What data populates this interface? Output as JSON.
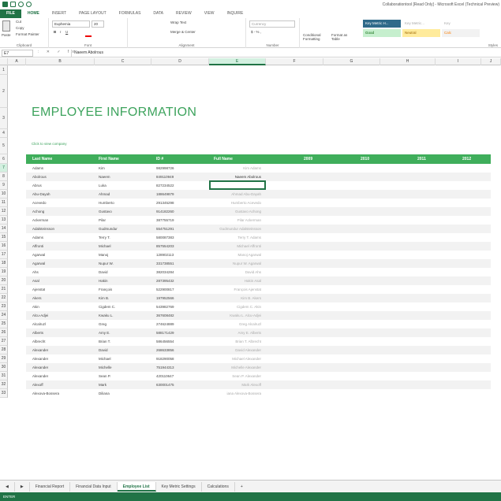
{
  "window": {
    "title": "Collaborationtool [Read Only] - Microsoft Excel (Technical Preview)"
  },
  "tabs": [
    "FILE",
    "HOME",
    "INSERT",
    "PAGE LAYOUT",
    "FORMULAS",
    "DATA",
    "REVIEW",
    "VIEW",
    "INQUIRE"
  ],
  "ribbon": {
    "clipboard": {
      "label": "Clipboard",
      "paste": "Paste",
      "cut": "Cut",
      "copy": "Copy",
      "format_painter": "Format Painter"
    },
    "font": {
      "label": "Font",
      "name": "Euphemia",
      "size": "20"
    },
    "alignment": {
      "label": "Alignment",
      "wrap": "Wrap Text",
      "merge": "Merge & Center"
    },
    "number": {
      "label": "Number",
      "format": "Currency"
    },
    "styles": {
      "label": "Styles",
      "conditional": "Conditional Formatting",
      "format_table": "Format as Table",
      "cells": [
        "Key Metric H...",
        "Key Metric...",
        "Key",
        "Good",
        "Neutral",
        "Calc"
      ]
    }
  },
  "formula_bar": {
    "name_box": "E7",
    "content": "Naeem Abolrous"
  },
  "columns": [
    "A",
    "B",
    "C",
    "D",
    "E",
    "F",
    "G",
    "H",
    "I",
    "J"
  ],
  "rows": [
    "1",
    "2",
    "3",
    "4",
    "5",
    "6",
    "7",
    "8",
    "9",
    "10",
    "11",
    "12",
    "13",
    "14",
    "15",
    "16",
    "17",
    "18",
    "19",
    "20",
    "21",
    "22",
    "23",
    "24",
    "25",
    "26",
    "27",
    "28",
    "29",
    "30",
    "31",
    "32",
    "33"
  ],
  "sheet": {
    "title": "EMPLOYEE  INFORMATION",
    "link": "Click to view company",
    "headers": [
      "Last Name",
      "First Name",
      "ID #",
      "Full Name",
      "2009",
      "2010",
      "2011",
      "2012"
    ],
    "data": [
      [
        "Adams",
        "Kim",
        "982998726",
        "Kim Adams"
      ],
      [
        "Abolrous",
        "Naeem",
        "849110949",
        "Naeem Abolrous"
      ],
      [
        "Abrus",
        "Luka",
        "827234522",
        "Luka Abrus"
      ],
      [
        "Abu-Dayah",
        "Ahmad",
        "188649879",
        "Ahmad Abu-Dayah"
      ],
      [
        "Acevedo",
        "Humberto",
        "291345298",
        "Humberto Acevedo"
      ],
      [
        "Achong",
        "Gustavo",
        "914182260",
        "Gustavo Achong"
      ],
      [
        "Ackerman",
        "Pilar",
        "387755719",
        "Pilar Ackerman"
      ],
      [
        "Adalsteinsson",
        "Gudmundur",
        "554751291",
        "Gudmundur Adalsteinsson"
      ],
      [
        "Adams",
        "Terry T.",
        "580087383",
        "Terry T. Adams"
      ],
      [
        "Affronti",
        "Michael",
        "857554203",
        "Michael Affronti"
      ],
      [
        "Agarwal",
        "Manoj",
        "128902113",
        "Manoj Agarwal"
      ],
      [
        "Agarwal",
        "Nupur W.",
        "331738551",
        "Nupur W. Agarwal"
      ],
      [
        "Ahs",
        "David",
        "382034284",
        "David Ahs"
      ],
      [
        "Asal",
        "Hakin",
        "287395432",
        "Hakin Asal"
      ],
      [
        "Ajenstat",
        "François",
        "522900817",
        "François Ajenstat"
      ],
      [
        "Akers",
        "Kim B.",
        "197952566",
        "Kim B. Akers"
      ],
      [
        "Akin",
        "Cigdem C.",
        "543982769",
        "Cigdem C. Akin"
      ],
      [
        "Alcu-Adjei",
        "Kwaku L.",
        "367608482",
        "Kwaku L. Alcu-Adjei"
      ],
      [
        "Alcalruzl",
        "Greg",
        "274624889",
        "Greg Alcalruzl"
      ],
      [
        "Alberts",
        "Amy E.",
        "588171429",
        "Amy E. Alberts"
      ],
      [
        "Albrecht",
        "Brian T.",
        "586456554",
        "Brian T. Albrecht"
      ],
      [
        "Alexander",
        "David",
        "268633856",
        "David Alexander"
      ],
      [
        "Alexander",
        "Michael",
        "918290058",
        "Michael Alexander"
      ],
      [
        "Alexander",
        "Michelle",
        "751944313",
        "Michelle Alexander"
      ],
      [
        "Alexander",
        "Sean P.",
        "420110647",
        "Sean P. Alexander"
      ],
      [
        "Alexoff",
        "Mark",
        "630001475",
        "Mark Alexoff"
      ],
      [
        "Alexova-Bossera",
        "Diliana",
        "",
        "iana Alexova-Bossera"
      ]
    ]
  },
  "sheet_tabs": [
    "Financial Report",
    "Financial Data Input",
    "Employee List",
    "Key Metric Settings",
    "Calculations",
    "+"
  ],
  "active_sheet_tab": "Employee List",
  "status": "ENTER",
  "colors": {
    "accent": "#217346",
    "header_green": "#3fae5b",
    "title_green": "#3da35d"
  }
}
